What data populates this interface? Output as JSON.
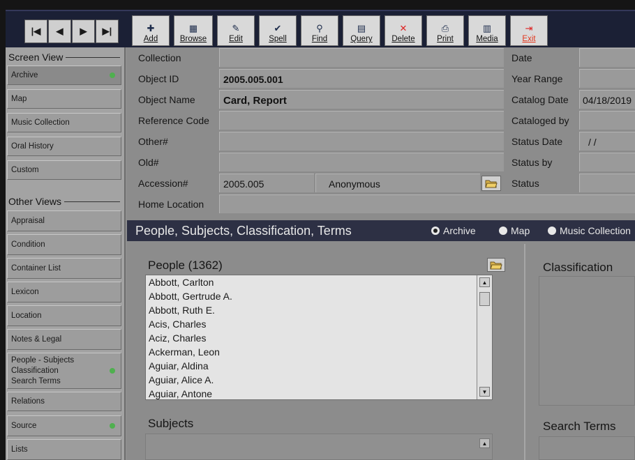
{
  "toolbar": {
    "nav": [
      {
        "glyph": "|◀",
        "icon": "first-record-icon"
      },
      {
        "glyph": "◀",
        "icon": "previous-record-icon"
      },
      {
        "glyph": "▶",
        "icon": "next-record-icon"
      },
      {
        "glyph": "▶|",
        "icon": "last-record-icon"
      }
    ],
    "buttons": [
      {
        "label": "Add",
        "icon": "plus-icon",
        "glyph": "✚"
      },
      {
        "label": "Browse",
        "icon": "grid-icon",
        "glyph": "▦"
      },
      {
        "label": "Edit",
        "icon": "edit-icon",
        "glyph": "✎"
      },
      {
        "label": "Spell",
        "icon": "spellcheck-icon",
        "glyph": "✔"
      },
      {
        "label": "Find",
        "icon": "binoculars-icon",
        "glyph": "⚲"
      },
      {
        "label": "Query",
        "icon": "query-icon",
        "glyph": "▤"
      },
      {
        "label": "Delete",
        "icon": "delete-x-icon",
        "glyph": "✕"
      },
      {
        "label": "Print",
        "icon": "printer-icon",
        "glyph": "⎙"
      },
      {
        "label": "Media",
        "icon": "film-strip-icon",
        "glyph": "▥"
      },
      {
        "label": "Exit",
        "icon": "exit-door-icon",
        "glyph": "⇥"
      }
    ]
  },
  "sidebar": {
    "screen_view_label": "Screen View",
    "screen_view_items": [
      {
        "label": "Archive",
        "dot": true,
        "active": true
      },
      {
        "label": "Map",
        "dot": false
      },
      {
        "label": "Music Collection",
        "dot": false
      },
      {
        "label": "Oral History",
        "dot": false
      },
      {
        "label": "Custom",
        "dot": false
      }
    ],
    "other_views_label": "Other Views",
    "other_views_items": [
      {
        "label": "Appraisal",
        "dot": false
      },
      {
        "label": "Condition",
        "dot": false
      },
      {
        "label": "Container List",
        "dot": false
      },
      {
        "label": "Lexicon",
        "dot": false
      },
      {
        "label": "Location",
        "dot": false
      },
      {
        "label": "Notes & Legal",
        "dot": false
      },
      {
        "label": "People - Subjects\nClassification\nSearch Terms",
        "dot": true
      },
      {
        "label": "Relations",
        "dot": false
      },
      {
        "label": "Source",
        "dot": true
      },
      {
        "label": "Lists",
        "dot": false
      }
    ]
  },
  "form": {
    "left_fields": [
      {
        "label": "Collection",
        "value": ""
      },
      {
        "label": "Object ID",
        "value": "2005.005.001"
      },
      {
        "label": "Object Name",
        "value": "Card, Report"
      },
      {
        "label": "Reference Code",
        "value": ""
      },
      {
        "label": "Other#",
        "value": ""
      },
      {
        "label": "Old#",
        "value": ""
      },
      {
        "label": "Accession#",
        "value": "2005.005",
        "extra": "Anonymous"
      },
      {
        "label": "Home Location",
        "value": ""
      }
    ],
    "right_fields": [
      {
        "label": "Date",
        "value": ""
      },
      {
        "label": "Year Range",
        "value": ""
      },
      {
        "label": "Catalog Date",
        "value": "04/18/2019"
      },
      {
        "label": "Cataloged by",
        "value": ""
      },
      {
        "label": "Status Date",
        "value": "/ /"
      },
      {
        "label": "Status by",
        "value": ""
      },
      {
        "label": "Status",
        "value": ""
      }
    ]
  },
  "section": {
    "title": "People, Subjects, Classification, Terms",
    "radios": [
      {
        "label": "Archive",
        "selected": true
      },
      {
        "label": "Map",
        "selected": false
      },
      {
        "label": "Music Collection",
        "selected": false
      }
    ]
  },
  "people": {
    "title": "People (1362)",
    "items": [
      "Abbott, Carlton",
      "Abbott, Gertrude A.",
      "Abbott, Ruth E.",
      "Acis, Charles",
      "Aciz, Charles",
      "Ackerman, Leon",
      "Aguiar, Aldina",
      "Aguiar, Alice A.",
      "Aguiar, Antone"
    ]
  },
  "classification": {
    "title": "Classification"
  },
  "subjects": {
    "title": "Subjects"
  },
  "search_terms": {
    "title": "Search Terms"
  }
}
